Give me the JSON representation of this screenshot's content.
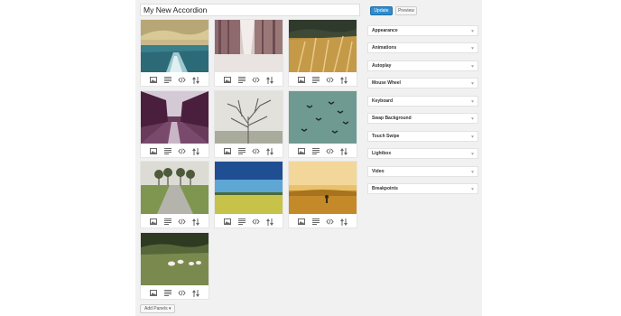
{
  "editor": {
    "title_value": "My New Accordion",
    "add_panels_label": "Add Panels ▾"
  },
  "toolbar": {
    "update_label": "Update",
    "preview_label": "Preview"
  },
  "settings": {
    "sections": [
      {
        "label": "Appearance"
      },
      {
        "label": "Animations"
      },
      {
        "label": "Autoplay"
      },
      {
        "label": "Mouse Wheel"
      },
      {
        "label": "Keyboard"
      },
      {
        "label": "Swap Background"
      },
      {
        "label": "Touch Swipe"
      },
      {
        "label": "Lightbox"
      },
      {
        "label": "Video"
      },
      {
        "label": "Breakpoints"
      }
    ]
  },
  "panels": [
    {
      "image": "ocean-wake"
    },
    {
      "image": "snowy-forest-road"
    },
    {
      "image": "golden-grass"
    },
    {
      "image": "canal-trees"
    },
    {
      "image": "bare-tree"
    },
    {
      "image": "flying-birds"
    },
    {
      "image": "tree-lined-path"
    },
    {
      "image": "blue-sky-field"
    },
    {
      "image": "sunset-field"
    },
    {
      "image": "sheep-meadow"
    }
  ],
  "panel_tools": [
    "image-icon",
    "text-icon",
    "html-icon",
    "sort-icon"
  ],
  "colors": {
    "primary_button": "#2e8ccf",
    "panel_background": "#f1f1f1"
  }
}
